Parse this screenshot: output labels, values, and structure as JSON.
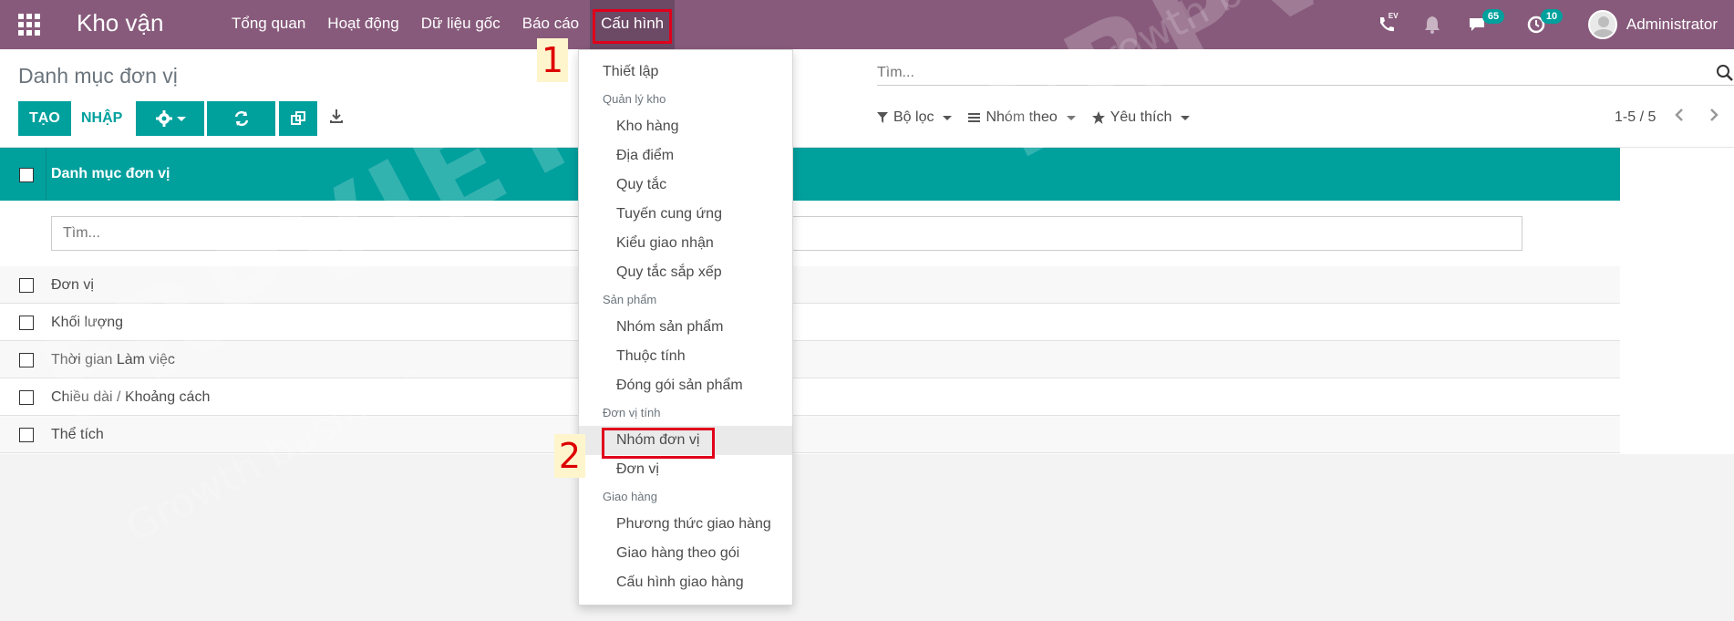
{
  "app": {
    "title": "Kho vận"
  },
  "nav": {
    "items": [
      "Tổng quan",
      "Hoạt động",
      "Dữ liệu gốc",
      "Báo cáo",
      "Cấu hình"
    ]
  },
  "topbar": {
    "messages_count": "65",
    "activities_count": "10",
    "user_name": "Administrator",
    "ev_label": "EV"
  },
  "control": {
    "breadcrumb": "Danh mục đơn vị",
    "create_label": "TẠO",
    "import_label": "NHẬP",
    "search_placeholder": "Tìm...",
    "filter_label": "Bộ lọc",
    "group_label": "Nhóm theo",
    "favorites_label": "Yêu thích",
    "pager": "1-5 / 5"
  },
  "list": {
    "column": "Danh mục đơn vị",
    "filter_placeholder": "Tìm...",
    "rows": [
      "Đơn vị",
      "Khối lượng",
      "Thời gian Làm việc",
      "Chiều dài / Khoảng cách",
      "Thể tích"
    ]
  },
  "dropdown": {
    "settings": "Thiết lập",
    "section_warehouse": "Quản lý kho",
    "warehouse_items": [
      "Kho hàng",
      "Địa điểm",
      "Quy tắc",
      "Tuyến cung ứng",
      "Kiểu giao nhận",
      "Quy tắc sắp xếp"
    ],
    "section_product": "Sản phẩm",
    "product_items": [
      "Nhóm sản phẩm",
      "Thuộc tính",
      "Đóng gói sản phẩm"
    ],
    "section_uom": "Đơn vị tính",
    "uom_items": [
      "Nhóm đơn vị",
      "Đơn vị"
    ],
    "section_delivery": "Giao hàng",
    "delivery_items": [
      "Phương thức giao hàng",
      "Giao hàng theo gói",
      "Cấu hình giao hàng"
    ]
  },
  "annotations": {
    "step1": "1",
    "step2": "2"
  },
  "watermark": {
    "brand": "ERPVIET",
    "tagline": "Growth business"
  },
  "colors": {
    "navbar": "#875a7b",
    "accent": "#00a09d",
    "highlight": "#e0001b"
  }
}
